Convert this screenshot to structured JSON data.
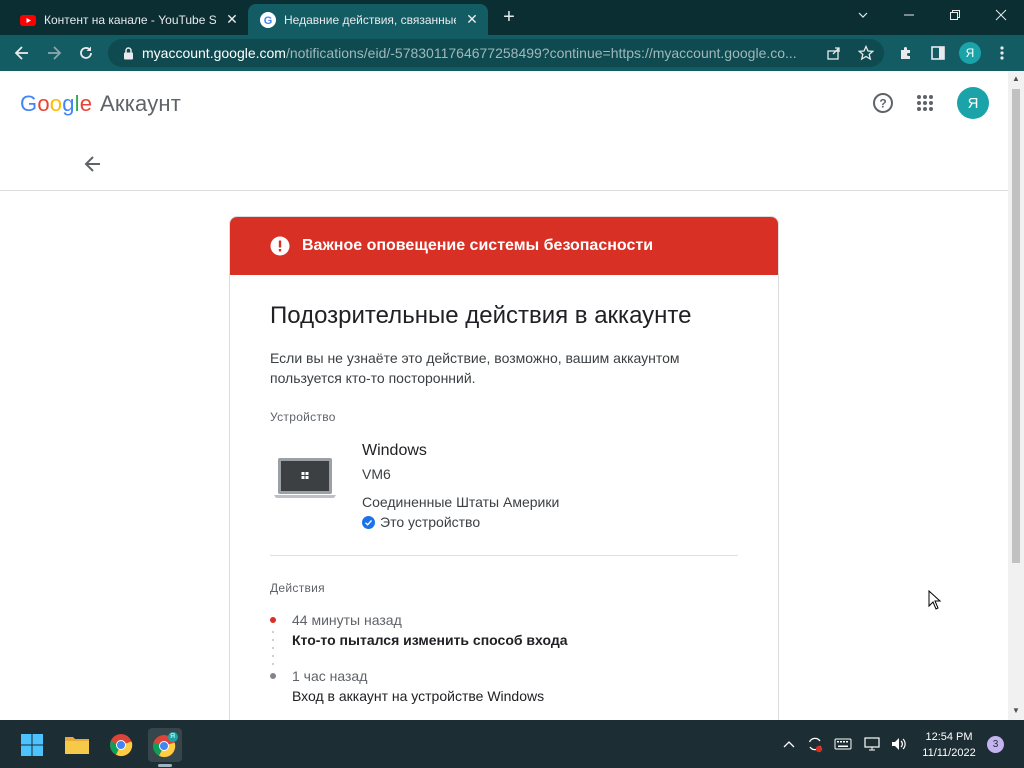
{
  "browser": {
    "tabs": [
      {
        "title": "Контент на канале - YouTube Studio",
        "favicon": "youtube-icon"
      },
      {
        "title": "Недавние действия, связанные с аккаунтом",
        "favicon": "google-icon",
        "active": true
      }
    ],
    "address": {
      "host": "myaccount.google.com",
      "path": "/notifications/eid/-5783011764677258499?continue=https://myaccount.google.co..."
    },
    "profile_initial": "Я"
  },
  "header": {
    "logo_google": "Google",
    "logo_suffix": "Аккаунт",
    "avatar_initial": "Я"
  },
  "alert": {
    "banner": "Важное оповещение системы безопасности",
    "title": "Подозрительные действия в аккаунте",
    "description": "Если вы не узнаёте это действие, возможно, вашим аккаунтом пользуется кто-то посторонний."
  },
  "device": {
    "section_label": "Устройство",
    "name": "Windows",
    "model": "VM6",
    "location": "Соединенные Штаты Америки",
    "this_device": "Это устройство"
  },
  "actions": {
    "section_label": "Действия",
    "items": [
      {
        "time": "44 минуты назад",
        "text": "Кто-то пытался изменить способ входа",
        "dot_color": "#d93025",
        "bold": true
      },
      {
        "time": "1 час назад",
        "text": "Вход в аккаунт на устройстве Windows",
        "dot_color": "#80868b",
        "bold": false
      }
    ]
  },
  "taskbar": {
    "time": "12:54 PM",
    "date": "11/11/2022",
    "notifications": "3",
    "chrome_badge": "Я"
  },
  "colors": {
    "alert_red": "#d93025",
    "browser_frame": "#0b2e33",
    "browser_toolbar": "#145c63",
    "avatar_teal": "#1aa3a8"
  }
}
